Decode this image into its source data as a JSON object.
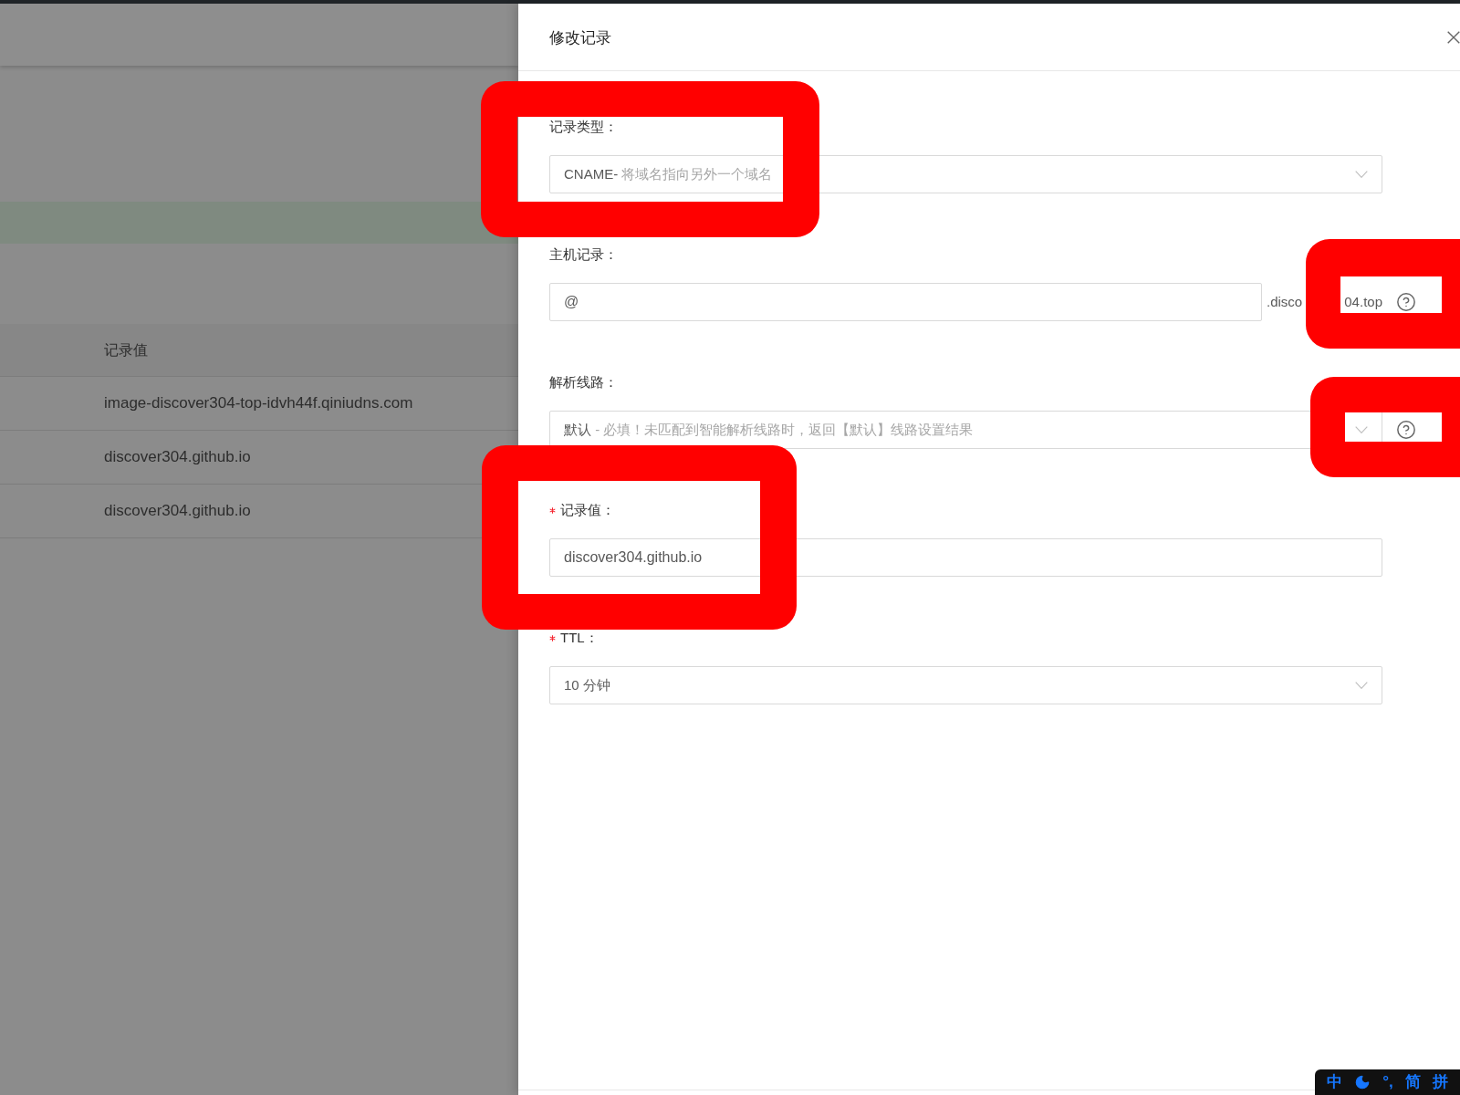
{
  "background_page": {
    "table": {
      "columns": [
        "记录值"
      ],
      "rows": [
        [
          "image-discover304-top-idvh44f.qiniudns.com"
        ],
        [
          "discover304.github.io"
        ],
        [
          "discover304.github.io"
        ]
      ]
    }
  },
  "drawer": {
    "title": "修改记录",
    "fields": [
      {
        "kind": "select",
        "label": "记录类型：",
        "required": false,
        "value": "CNAME-",
        "description": "将域名指向另外一个域名"
      },
      {
        "kind": "input_suffix",
        "label": "主机记录：",
        "required": false,
        "value": "@",
        "suffix": [
          ".disco",
          "04.top"
        ]
      },
      {
        "kind": "select_help",
        "label": "解析线路：",
        "required": false,
        "value": "默认",
        "description": "- 必填！未匹配到智能解析线路时，返回【默认】线路设置结果"
      },
      {
        "kind": "input",
        "label": "记录值：",
        "required": true,
        "value": "discover304.github.io"
      },
      {
        "kind": "select",
        "label": "TTL：",
        "required": true,
        "value": "10 分钟"
      }
    ]
  },
  "annotations": [
    {
      "kind": "highlight_frame"
    },
    {
      "kind": "highlight_frame"
    },
    {
      "kind": "highlight_frame"
    },
    {
      "kind": "highlight_frame"
    }
  ],
  "ime_toolbar": {
    "mode": "中",
    "punctuation": "°,",
    "script": "简",
    "input_method": "拼"
  }
}
